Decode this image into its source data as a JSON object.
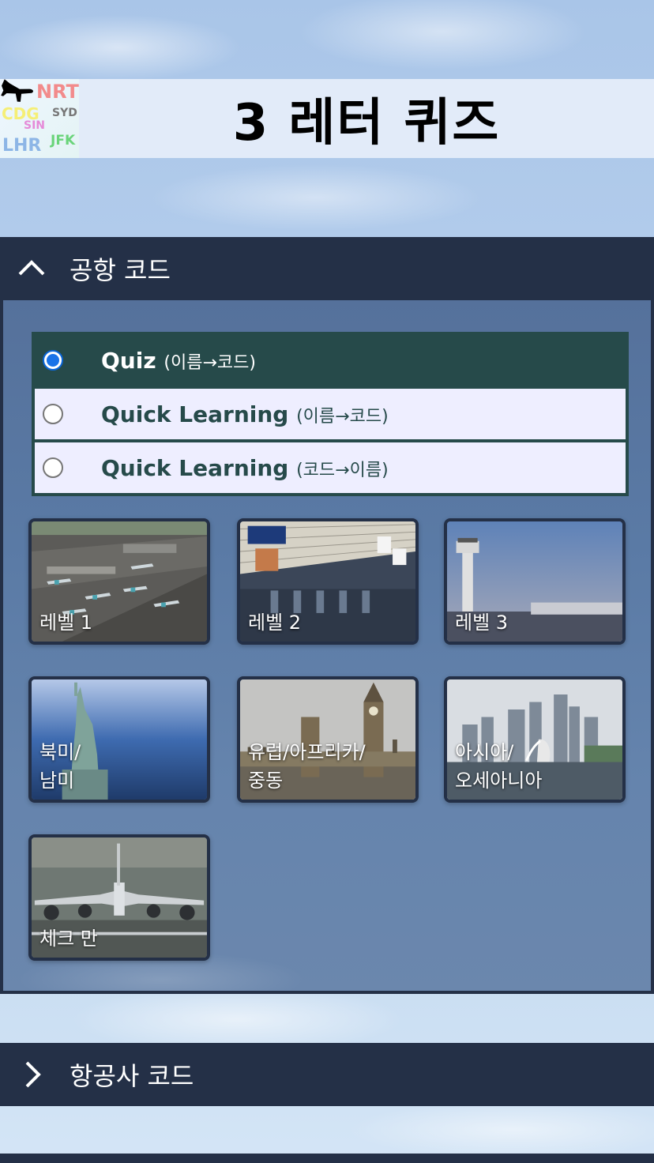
{
  "header": {
    "title": "3 레터 퀴즈",
    "logo_codes": [
      "NRT",
      "CDG",
      "SYD",
      "SIN",
      "LHR",
      "JFK"
    ]
  },
  "airport_section": {
    "label": "공항 코드",
    "expanded": true,
    "icon": "chevron-up-icon"
  },
  "modes": [
    {
      "label": "Quiz",
      "sub": "(이름→코드)",
      "checked": true
    },
    {
      "label": "Quick Learning",
      "sub": "(이름→코드)",
      "checked": false
    },
    {
      "label": "Quick Learning",
      "sub": "(코드→이름)",
      "checked": false
    }
  ],
  "tiles": [
    {
      "label": "레벨 1",
      "theme": "airport-aerial"
    },
    {
      "label": "레벨 2",
      "theme": "terminal-interior"
    },
    {
      "label": "레벨 3",
      "theme": "control-tower"
    },
    {
      "label": "북미/\n남미",
      "theme": "statue-of-liberty"
    },
    {
      "label": "유럽/아프리카/\n중동",
      "theme": "big-ben"
    },
    {
      "label": "아시아/\n오세아니아",
      "theme": "singapore-skyline"
    },
    {
      "label": "체크 만",
      "theme": "airplane-landing"
    }
  ],
  "airline_section": {
    "label": "항공사 코드",
    "expanded": false,
    "icon": "chevron-right-icon"
  },
  "colors": {
    "bar": "#243047",
    "option_selected": "#264a4a",
    "option_bg": "#eeeeff",
    "radio_checked": "#1a73e8"
  }
}
